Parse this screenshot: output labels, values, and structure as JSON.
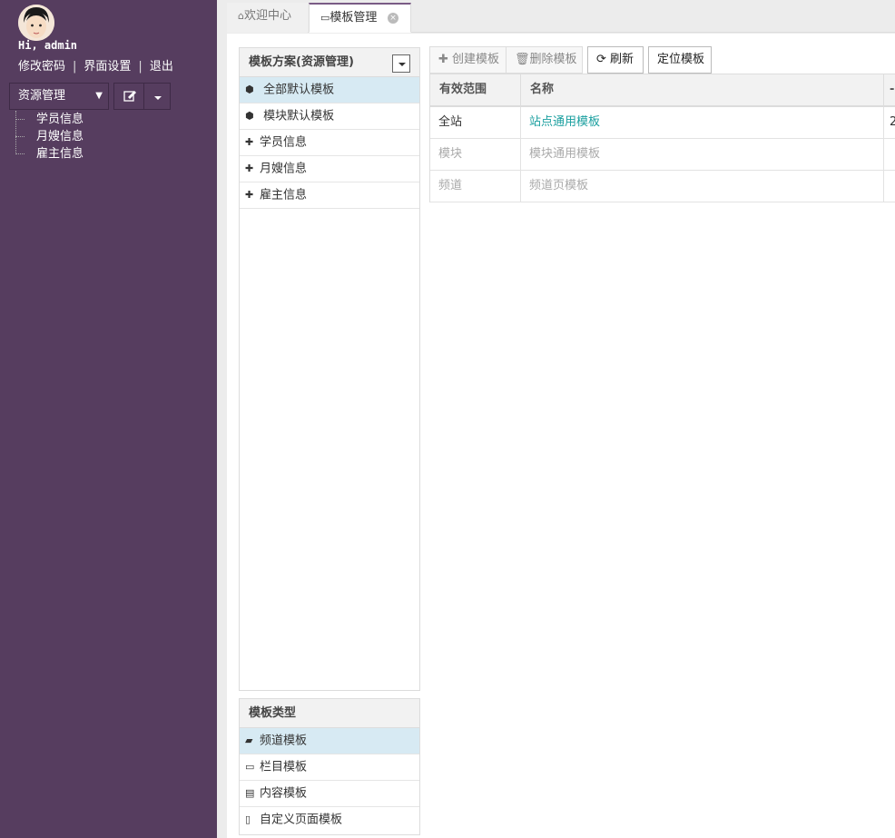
{
  "sidebar": {
    "greeting": "Hi, admin",
    "links": [
      "修改密码",
      "界面设置",
      "退出"
    ],
    "dept_select": "资源管理",
    "tree": [
      "学员信息",
      "月嫂信息",
      "雇主信息"
    ]
  },
  "tabs": [
    {
      "label": "欢迎中心",
      "icon": "home-icon"
    },
    {
      "label": "模板管理",
      "icon": "laptop-icon"
    }
  ],
  "scheme_panel": {
    "title": "模板方案(资源管理)",
    "items": [
      {
        "label": "全部默认模板",
        "icon": "cube-icon",
        "active": true
      },
      {
        "label": "模块默认模板",
        "icon": "cube-icon",
        "active": false
      },
      {
        "label": "学员信息",
        "icon": "puzzle-icon",
        "active": false
      },
      {
        "label": "月嫂信息",
        "icon": "puzzle-icon",
        "active": false
      },
      {
        "label": "雇主信息",
        "icon": "puzzle-icon",
        "active": false
      }
    ]
  },
  "type_panel": {
    "title": "模板类型",
    "items": [
      {
        "label": "频道模板",
        "icon": "book-icon",
        "active": true
      },
      {
        "label": "栏目模板",
        "icon": "folder-icon",
        "active": false
      },
      {
        "label": "内容模板",
        "icon": "file-text-icon",
        "active": false
      },
      {
        "label": "自定义页面模板",
        "icon": "file-icon",
        "active": false
      }
    ]
  },
  "toolbar": {
    "create": "创建模板",
    "delete": "删除模板",
    "refresh": "刷新",
    "locate": "定位模板"
  },
  "grid": {
    "columns": [
      "有效范围",
      "名称",
      "-"
    ],
    "rows": [
      {
        "scope": "全站",
        "name": "站点通用模板",
        "extra": "2",
        "muted": false
      },
      {
        "scope": "模块",
        "name": "模块通用模板",
        "extra": "",
        "muted": true
      },
      {
        "scope": "频道",
        "name": "频道页模板",
        "extra": "",
        "muted": true
      }
    ]
  },
  "colors": {
    "sidebar_bg": "#563d5f",
    "active_row": "#d7eaf3",
    "link": "#1a9f9f"
  }
}
